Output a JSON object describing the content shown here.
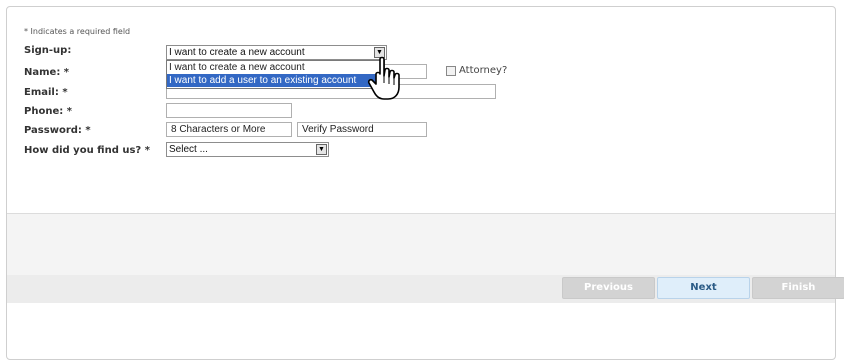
{
  "form": {
    "required_note": "* Indicates a required field",
    "labels": {
      "signup": "Sign-up:",
      "name": "Name: *",
      "email": "Email: *",
      "phone": "Phone: *",
      "password": "Password: *",
      "find_us": "How did you find us? *"
    },
    "signup_select": {
      "value": "I want to create a new account",
      "options": [
        "I want to create a new account",
        "I want to add a user to an existing account"
      ],
      "highlighted": "I want to add a user to an existing account"
    },
    "attorney_label": "Attorney?",
    "name_value": "",
    "email_value": "",
    "phone_value": "",
    "password_placeholder": "8 Characters or More",
    "verify_placeholder": "Verify Password",
    "find_us_select": {
      "value": "Select ..."
    }
  },
  "buttons": {
    "previous": "Previous",
    "next": "Next",
    "finish": "Finish"
  },
  "colors": {
    "highlight": "#3368c4",
    "next_bg": "#dfeefa",
    "disabled_bg": "#d3d3d3"
  }
}
